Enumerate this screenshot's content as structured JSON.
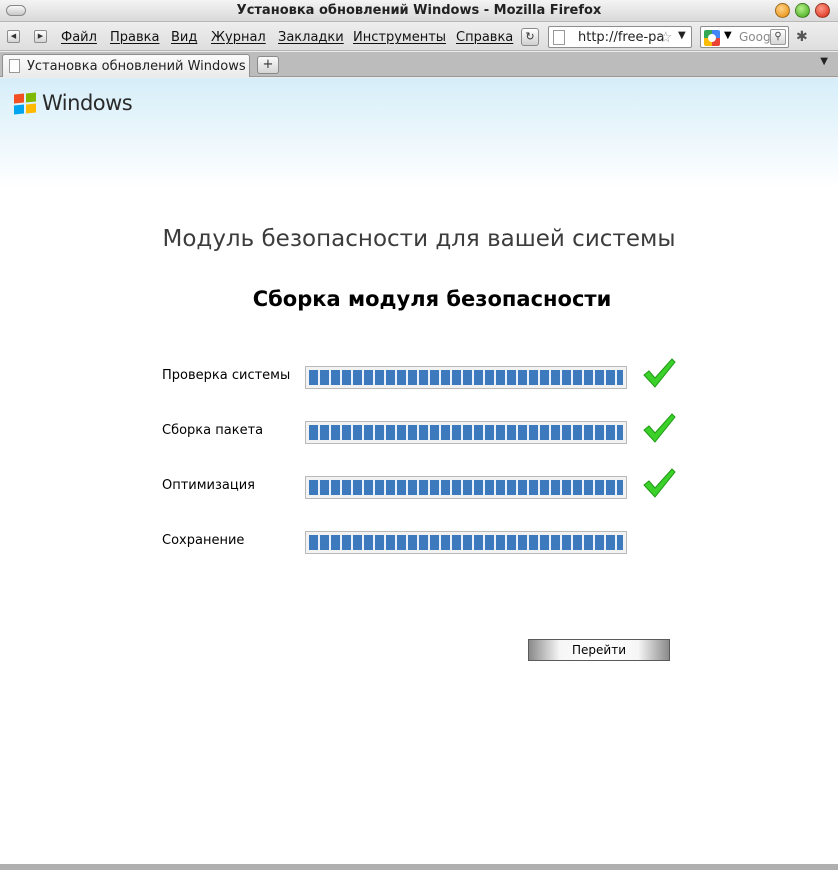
{
  "window": {
    "title": "Установка обновлений Windows - Mozilla Firefox"
  },
  "menu": {
    "items": [
      "Файл",
      "Правка",
      "Вид",
      "Журнал",
      "Закладки",
      "Инструменты",
      "Справка"
    ]
  },
  "urlbar": {
    "url": "http://free-pa",
    "icon": "page-icon"
  },
  "search": {
    "placeholder": "Goog",
    "engine_icon": "google-icon"
  },
  "tabs": [
    {
      "label": "Установка обновлений Windows"
    }
  ],
  "page": {
    "logo_text": "Windows",
    "heading": "Модуль безопасности для вашей системы",
    "subheading": "Сборка модуля безопасности",
    "steps": [
      {
        "label": "Проверка системы",
        "progress": 1.0,
        "done": true
      },
      {
        "label": "Сборка пакета",
        "progress": 1.0,
        "done": true
      },
      {
        "label": "Оптимизация",
        "progress": 1.0,
        "done": true
      },
      {
        "label": "Сохранение",
        "progress": 1.0,
        "done": false
      }
    ],
    "button_label": "Перейти"
  },
  "colors": {
    "progress_fill": "#3c79bd",
    "check": "#3bd12a"
  }
}
